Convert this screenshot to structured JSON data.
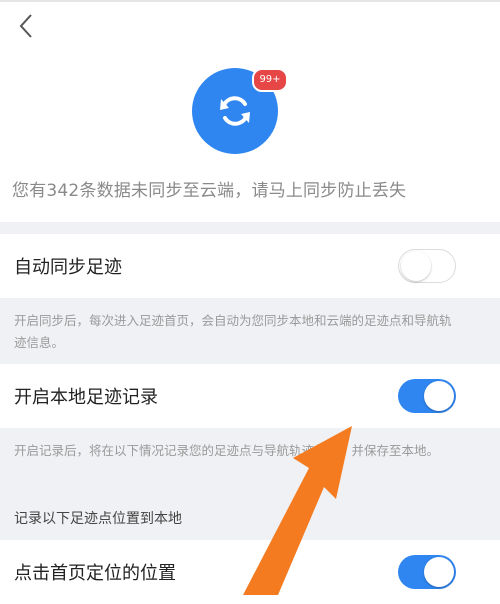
{
  "header": {
    "back_icon": "chevron-left-icon"
  },
  "sync": {
    "icon": "sync-icon",
    "badge": "99+",
    "message": "您有342条数据未同步至云端，请马上同步防止丢失"
  },
  "settings": {
    "auto_sync": {
      "label": "自动同步足迹",
      "enabled": false,
      "note": "开启同步后，每次进入足迹首页，会自动为您同步本地和云端的足迹点和导航轨迹信息。"
    },
    "local_record": {
      "label": "开启本地足迹记录",
      "enabled": true,
      "note": "开启记录后，将在以下情况记录您的足迹点与导航轨迹信息，并保存至本地。"
    },
    "record_section_title": "记录以下足迹点位置到本地",
    "home_location": {
      "label": "点击首页定位的位置",
      "enabled": true
    }
  },
  "colors": {
    "accent": "#2f86f0",
    "badge": "#e64646",
    "arrow": "#f47b20",
    "section_bg": "#f0f1f4"
  }
}
